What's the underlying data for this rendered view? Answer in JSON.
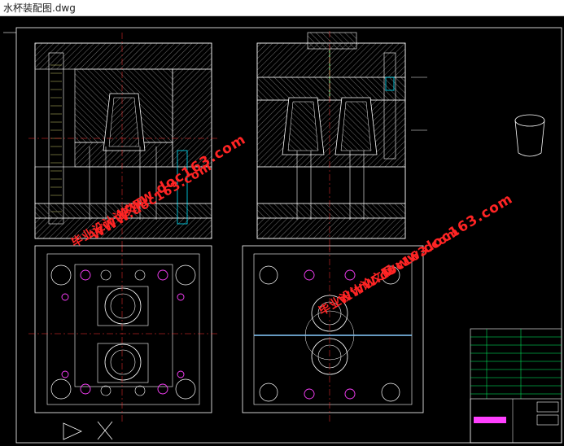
{
  "window": {
    "title": "水杯装配图.dwg"
  },
  "watermarks": [
    {
      "site": "www.doc163.com",
      "label": "毕业设计论文网",
      "url": "WWW.doc163.com"
    },
    {
      "site": "www.doc163.com",
      "label": "毕业设计论文网",
      "url": "WWW.doc163.com"
    }
  ],
  "colors": {
    "background": "#000000",
    "frame": "#ffffff",
    "centerline": "#ff3030",
    "hatch": "#8c8c8c",
    "pins": "#ff40ff",
    "cooling": "#00e5ff",
    "titleblock": "#00ff66"
  }
}
